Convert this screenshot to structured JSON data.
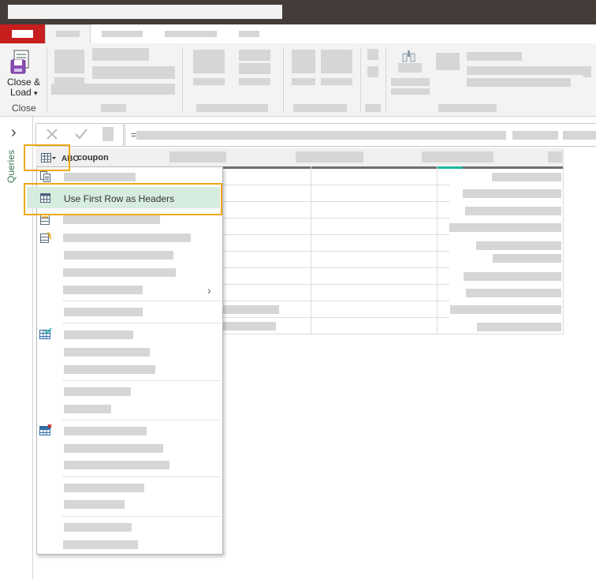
{
  "ribbon": {
    "close_load_line1": "Close &",
    "close_load_line2": "Load",
    "close_group_label": "Close",
    "dropdown_arrow": "▾"
  },
  "sidebar": {
    "expand_chevron": "›",
    "queries_label": "Queries"
  },
  "formula_bar": {
    "equals": "="
  },
  "grid": {
    "column_type_label": "ABC",
    "column_name": "coupon"
  },
  "context_menu": {
    "selected_item_label": "Use First Row as Headers",
    "submenu_arrow": "›"
  },
  "colors": {
    "title_bar": "#433c38",
    "file_tab": "#c71e1e",
    "highlight_outline": "#f0a818",
    "selected_item_bg": "#d6ecdf",
    "column_quality_teal": "#1db7a0"
  },
  "icons": [
    "close-load-icon",
    "cancel-icon",
    "confirm-icon",
    "table-icon",
    "copy-icon",
    "use-first-row-icon",
    "remove-rows-icon"
  ]
}
